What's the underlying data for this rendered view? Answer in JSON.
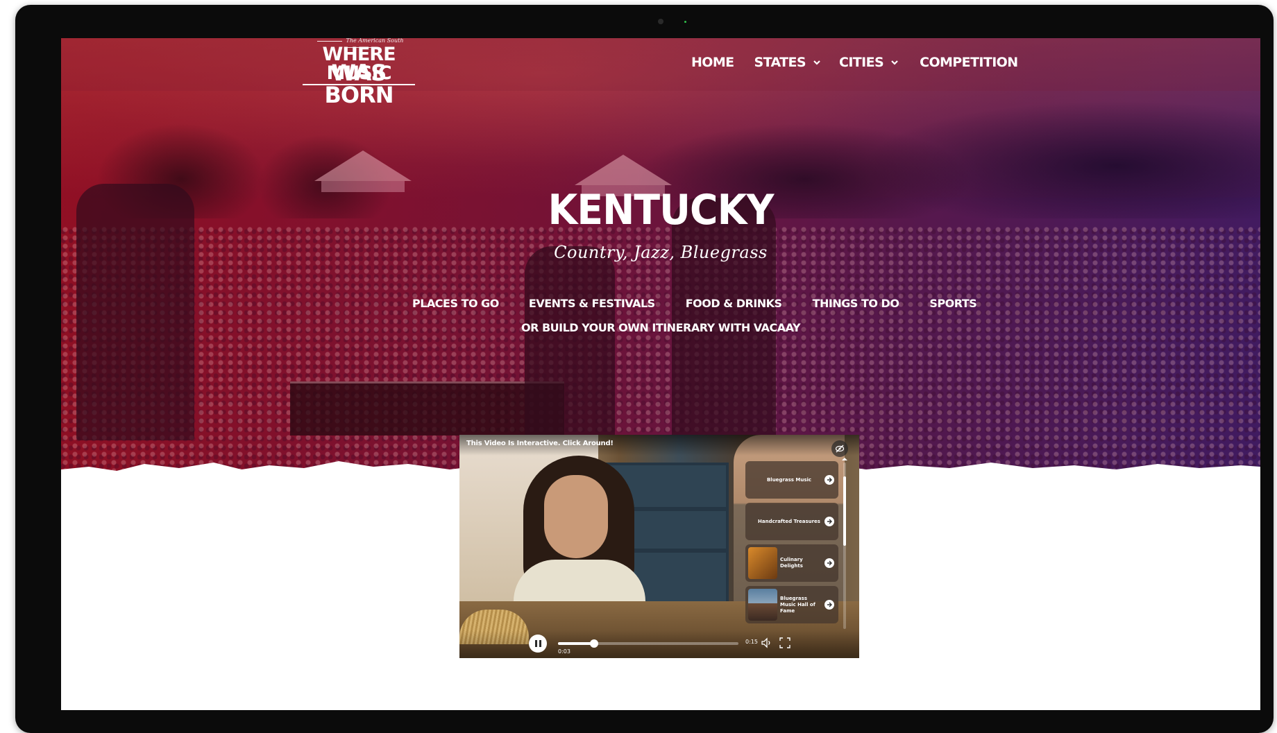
{
  "site": {
    "logo": {
      "tagline": "The American South",
      "line1": "WHERE MUSIC",
      "line2": "WAS BORN"
    },
    "nav": {
      "home": "HOME",
      "states": "STATES",
      "cities": "CITIES",
      "competition": "COMPETITION"
    }
  },
  "hero": {
    "title": "KENTUCKY",
    "subtitle": "Country, Jazz, Bluegrass",
    "categories": {
      "places": "PLACES TO GO",
      "events": "EVENTS & FESTIVALS",
      "food": "FOOD & DRINKS",
      "things": "THINGS TO DO",
      "sports": "SPORTS"
    },
    "cta": "OR BUILD YOUR OWN ITINERARY WITH VACAAY"
  },
  "video": {
    "banner": "This Video Is Interactive. Click Around!",
    "panel": [
      {
        "label": "Bluegrass Music"
      },
      {
        "label": "Handcrafted Treasures"
      },
      {
        "label": "Culinary Delights"
      },
      {
        "label": "Bluegrass Music Hall of Fame"
      }
    ],
    "current_time": "0:03",
    "duration": "0:15",
    "progress": 0.2
  },
  "colors": {
    "hero_red": "#aa1024",
    "hero_purple": "#481e6e",
    "frame": "#0b0b0b"
  },
  "icons": {
    "chevron": "chevron-down-icon",
    "hide": "eye-slash-icon",
    "go": "arrow-right-icon",
    "pause": "pause-icon",
    "volume": "volume-icon",
    "fullscreen": "fullscreen-icon"
  }
}
